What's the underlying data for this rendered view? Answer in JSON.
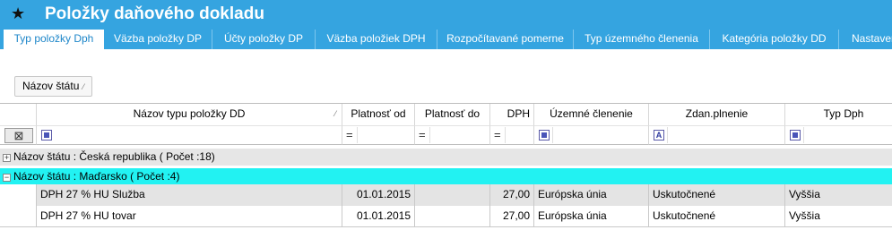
{
  "window": {
    "title": "Položky daňového dokladu",
    "icon": "star-icon"
  },
  "tabs": [
    "Typ položky Dph",
    "Väzba položky DP",
    "Účty položky DP",
    "Väzba položiek DPH",
    "Rozpočítavané pomerne",
    "Typ územného členenia",
    "Kategória položky DD",
    "Nastaven"
  ],
  "group_by": {
    "label": "Názov štátu",
    "sort_icon": "sort-indicator-icon"
  },
  "columns": {
    "name": "Názov typu položky DD",
    "valid_from": "Platnosť od",
    "valid_to": "Platnosť do",
    "vat": "DPH",
    "territory": "Územné členenie",
    "taxable": "Zdan.plnenie",
    "vat_type": "Typ Dph"
  },
  "filter": {
    "eq": "=",
    "text_icon": "A"
  },
  "groups": [
    {
      "label": "Názov štátu : Česká republika ( Počet :18)",
      "expander": "+"
    },
    {
      "label": "Názov štátu : Maďarsko ( Počet :4)",
      "expander": "−"
    }
  ],
  "rows": [
    {
      "name": "DPH 27 % HU Služba",
      "valid_from": "01.01.2015",
      "valid_to": "",
      "vat": "27,00",
      "territory": "Európska únia",
      "taxable": "Uskutočnené",
      "vat_type": "Vyššia"
    },
    {
      "name": "DPH 27 % HU tovar",
      "valid_from": "01.01.2015",
      "valid_to": "",
      "vat": "27,00",
      "territory": "Európska únia",
      "taxable": "Uskutočnené",
      "vat_type": "Vyššia"
    }
  ],
  "colors": {
    "accent": "#35a4e0",
    "selected_group": "#22f2f2",
    "group_bg": "#e6e6e6",
    "row_alt": "#e4e4e4"
  }
}
